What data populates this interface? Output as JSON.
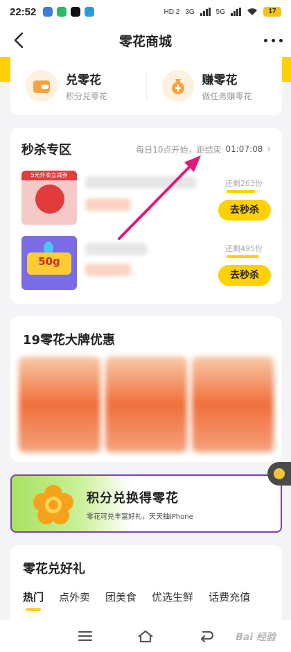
{
  "status_bar": {
    "time": "22:52",
    "network_1": "HD 2",
    "network_2": "3G",
    "network_3": "5G",
    "battery": "17"
  },
  "nav": {
    "title": "零花商城"
  },
  "exchange": {
    "items": [
      {
        "title": "兑零花",
        "subtitle": "积分兑零花",
        "icon": "wallet-icon"
      },
      {
        "title": "赚零花",
        "subtitle": "做任务赚零花",
        "icon": "money-bag-icon"
      }
    ]
  },
  "flash_sale": {
    "title": "秒杀专区",
    "info": "每日10点开始，距结束",
    "countdown": "01:07:08",
    "items": [
      {
        "image_tag": "5元外卖立减券",
        "remain": "还剩263份",
        "remain_fraction": 0.85,
        "button": "去秒杀"
      },
      {
        "image_tag": "50g",
        "remain": "还剩495份",
        "remain_fraction": 0.95,
        "button": "去秒杀"
      }
    ]
  },
  "brand": {
    "title": "19零花大牌优惠"
  },
  "promo": {
    "title": "积分兑换得零花",
    "subtitle": "零花可兑丰富好礼，天天抽iPhone"
  },
  "gifts": {
    "title": "零花兑好礼",
    "tabs": [
      "热门",
      "点外卖",
      "团美食",
      "优选生鲜",
      "话费充值"
    ]
  },
  "colors": {
    "accent": "#ffd100",
    "annotation_arrow": "#e0197a",
    "promo_border": "#7c3fb5"
  }
}
